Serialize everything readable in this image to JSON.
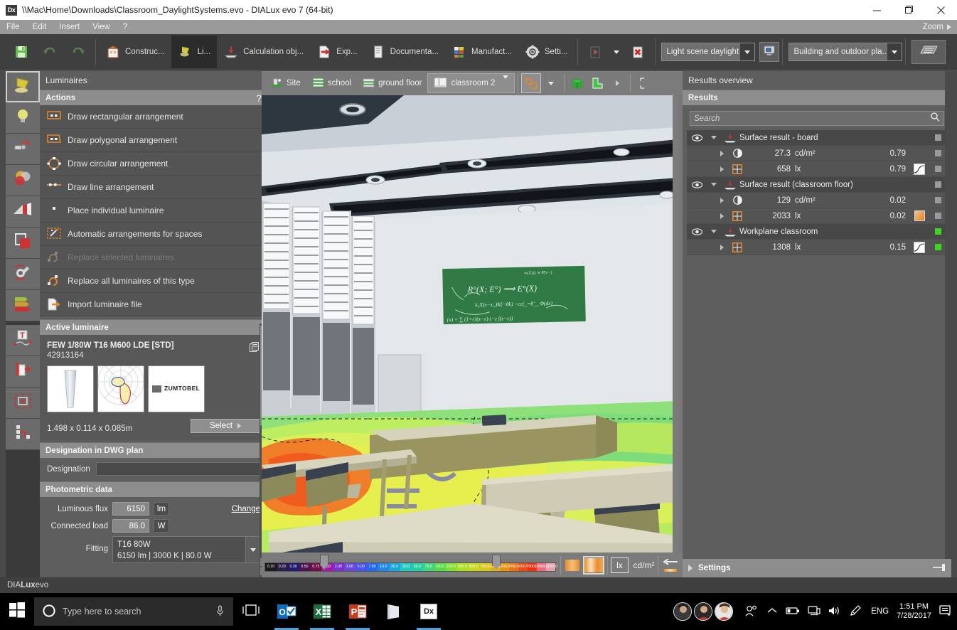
{
  "titlebar": {
    "app_icon": "dialux-icon",
    "title": "\\\\Mac\\Home\\Downloads\\Classroom_DaylightSystems.evo - DIALux evo 7  (64-bit)",
    "minimize": "—",
    "maximize": "❐",
    "close": "✕"
  },
  "menubar": {
    "items": [
      "File",
      "Edit",
      "Insert",
      "View",
      "?"
    ],
    "zoom_label": "Zoom"
  },
  "ribbon": {
    "save_label": "",
    "undo_label": "",
    "redo_label": "",
    "tabs": [
      {
        "label": "Construc...",
        "icon": "building-icon",
        "active": false
      },
      {
        "label": "Li...",
        "icon": "luminaire-icon",
        "active": true
      },
      {
        "label": "Calculation obj...",
        "icon": "calculation-object-icon",
        "active": false
      },
      {
        "label": "Exp...",
        "icon": "export-icon",
        "active": false
      },
      {
        "label": "Documenta...",
        "icon": "document-icon",
        "active": false
      },
      {
        "label": "Manufact...",
        "icon": "manufacturer-icon",
        "active": false
      },
      {
        "label": "Setti...",
        "icon": "gear-icon",
        "active": false
      }
    ],
    "calc_start_label": "",
    "calc_stop_label": "",
    "light_scene": "Light scene daylight",
    "light_scene_btn": "monitor-icon",
    "view_mode": "Building and outdoor pla...",
    "render_btn": "render-icon"
  },
  "rail": {
    "items": [
      {
        "name": "luminaire-tool",
        "icon": "spotlight-icon",
        "active": true
      },
      {
        "name": "lamp-tool",
        "icon": "bulb-icon",
        "active": false
      },
      {
        "name": "light-scene-tool",
        "icon": "light-scene-icon",
        "active": false
      },
      {
        "name": "color-tool",
        "icon": "color-circles-icon",
        "active": false
      },
      {
        "name": "light-direction-tool",
        "icon": "beam-icon",
        "active": false
      },
      {
        "name": "surface-tool",
        "icon": "surface-icon",
        "active": false
      },
      {
        "name": "maintenance-tool",
        "icon": "wrench-icon",
        "active": false
      },
      {
        "name": "false-color-tool",
        "icon": "bars-icon",
        "active": false
      },
      {
        "name": "text-tool",
        "icon": "text-curve-icon",
        "active": false
      },
      {
        "name": "add-object-tool",
        "icon": "add-object-icon",
        "active": false
      },
      {
        "name": "select-area-tool",
        "icon": "select-area-icon",
        "active": false
      },
      {
        "name": "node-tool",
        "icon": "node-path-icon",
        "active": false
      }
    ]
  },
  "left_panel": {
    "title": "Luminaires",
    "actions_header": "Actions",
    "help_glyph": "?",
    "actions": [
      {
        "label": "Draw rectangular arrangement",
        "icon": "rect-arrangement-icon",
        "disabled": false
      },
      {
        "label": "Draw polygonal arrangement",
        "icon": "polygon-arrangement-icon",
        "disabled": false
      },
      {
        "label": "Draw circular arrangement",
        "icon": "circular-arrangement-icon",
        "disabled": false
      },
      {
        "label": "Draw line arrangement",
        "icon": "line-arrangement-icon",
        "disabled": false
      },
      {
        "label": "Place individual luminaire",
        "icon": "single-luminaire-icon",
        "disabled": false
      },
      {
        "label": "Automatic arrangements for spaces",
        "icon": "magic-wand-icon",
        "disabled": false
      },
      {
        "label": "Replace selected luminaires",
        "icon": "replace-icon",
        "disabled": true
      },
      {
        "label": "Replace all luminaires of this type",
        "icon": "replace-all-icon",
        "disabled": false
      },
      {
        "label": "Import luminaire file",
        "icon": "import-file-icon",
        "disabled": false
      }
    ],
    "active_luminaire": {
      "header": "Active luminaire",
      "name": "FEW 1/80W T16 M600 LDE [STD]",
      "id": "42913164",
      "copy_icon": "copy-icon",
      "brand": "ZUMTOBEL",
      "dimensions": "1.498 x 0.114 x 0.085m",
      "select_label": "Select"
    },
    "dwg": {
      "header": "Designation in DWG plan",
      "label": "Designation",
      "value": "",
      "placeholder": ""
    },
    "photometric": {
      "header": "Photometric data",
      "luminous_flux_label": "Luminous flux",
      "luminous_flux_value": "6150",
      "luminous_flux_unit": "lm",
      "connected_load_label": "Connected load",
      "connected_load_value": "86.0",
      "connected_load_unit": "W",
      "change_label": "Change",
      "fitting_label": "Fitting",
      "fitting_line1": "T16  80W",
      "fitting_line2": "6150 lm  |  3000 K  |  80.0 W"
    }
  },
  "viewport": {
    "breadcrumb": [
      {
        "label": "Site",
        "icon": "site-icon",
        "selected": false
      },
      {
        "label": "school",
        "icon": "building-stack-icon",
        "selected": false
      },
      {
        "label": "ground floor",
        "icon": "floor-icon",
        "selected": false
      },
      {
        "label": "classroom 2",
        "icon": "room-icon",
        "selected": true
      }
    ],
    "room_dropdown_arrow": "chevron-down-icon",
    "tools": [
      {
        "name": "plan-view-toggle",
        "icon": "plan-icon",
        "selected": true
      },
      {
        "name": "plan-view-dropdown",
        "icon": "chevron-down-icon",
        "selected": false
      },
      {
        "name": "3d-cube-view",
        "icon": "cube-icon",
        "selected": false
      },
      {
        "name": "lshape-view",
        "icon": "lshape-icon",
        "selected": false
      },
      {
        "name": "more-views",
        "icon": "chevron-right-icon",
        "selected": false
      },
      {
        "name": "crop-view",
        "icon": "crop-icon",
        "selected": false
      }
    ],
    "scale": {
      "values": [
        "0.10",
        "0.20",
        "0.30",
        "0.50",
        "0.75",
        "1.00",
        "2.00",
        "3.00",
        "5.00",
        "7.50",
        "10.0",
        "20.0",
        "30.0",
        "50.0",
        "75.0",
        "100.0",
        "200.0",
        "300.0",
        "500.0",
        "750.0",
        "1000.0",
        "2000.0",
        "3000.0",
        "5000.0",
        "7500.0",
        "10000.0",
        "15000.0"
      ],
      "colors": [
        "#1a1a1a",
        "#2e1f4a",
        "#241a6b",
        "#4b1450",
        "#6e1046",
        "#a018a8",
        "#7b2fd1",
        "#6a45de",
        "#4a4ff0",
        "#2266f5",
        "#1f86f0",
        "#15a8d8",
        "#1ec8c0",
        "#22cfa0",
        "#3fd57a",
        "#56dc44",
        "#7fe02f",
        "#a8e022",
        "#c6d81c",
        "#d9c818",
        "#e2b014",
        "#e89212",
        "#ec7210",
        "#ef4a0e",
        "#f2300c",
        "#f06a7a",
        "#e9a0ac"
      ],
      "legend_solid": "legend-solid-icon",
      "legend_gradient": "legend-gradient-icon",
      "unit_lx": "lx",
      "unit_cdm2": "cd/m²",
      "reset_icon": "reset-arrow-icon"
    }
  },
  "right_panel": {
    "title": "Results overview",
    "results_header": "Results",
    "search_placeholder": "Search",
    "search_icon": "search-icon",
    "groups": [
      {
        "name": "Surface result - board",
        "icon": "surface-result-icon",
        "eye_icon": "eye-icon",
        "expand_icon": "chevron-down-icon",
        "status": "grey",
        "rows": [
          {
            "icon": "luminance-icon",
            "value": "27.3",
            "unit": "cd/m²",
            "ratio": "0.79",
            "swatch": "none",
            "status": "grey"
          },
          {
            "icon": "grid-icon",
            "value": "658",
            "unit": "lx",
            "ratio": "0.79",
            "swatch": "isoline",
            "status": "grey"
          }
        ]
      },
      {
        "name": "Surface result (classroom floor)",
        "icon": "surface-result-icon",
        "eye_icon": "eye-icon",
        "expand_icon": "chevron-down-icon",
        "status": "grey",
        "rows": [
          {
            "icon": "luminance-icon",
            "value": "129",
            "unit": "cd/m²",
            "ratio": "0.02",
            "swatch": "none",
            "status": "grey"
          },
          {
            "icon": "grid-icon",
            "value": "2033",
            "unit": "lx",
            "ratio": "0.02",
            "swatch": "orange",
            "status": "grey"
          }
        ]
      },
      {
        "name": "Workplane classroom",
        "icon": "surface-result-icon",
        "eye_icon": "eye-icon",
        "expand_icon": "chevron-down-icon",
        "status": "green",
        "rows": [
          {
            "icon": "grid-icon",
            "value": "1308",
            "unit": "lx",
            "ratio": "0.15",
            "swatch": "isoline",
            "status": "green"
          }
        ]
      }
    ],
    "settings_label": "Settings",
    "settings_expand_icon": "chevron-right-icon",
    "pin_icon": "pin-icon"
  },
  "statusbar": {
    "text_bold": "DIALux",
    "text_a": "DIA",
    "text_b": "Lux",
    "text_c": "evo"
  },
  "taskbar": {
    "start_icon": "windows-start-icon",
    "search_placeholder": "Type here to search",
    "cortana_icon": "cortana-circle-icon",
    "mic_icon": "microphone-icon",
    "taskview_icon": "task-view-icon",
    "apps": [
      {
        "name": "outlook",
        "label": "O",
        "color": "#0f6cbd",
        "active": true
      },
      {
        "name": "excel",
        "label": "X",
        "color": "#1d6f42",
        "active": true
      },
      {
        "name": "powerpoint",
        "label": "P",
        "color": "#c43e1c",
        "active": true
      },
      {
        "name": "onenote",
        "label": "N",
        "color": "#7719aa",
        "active": false
      },
      {
        "name": "dialux",
        "label": "Dx",
        "color": "#3a3a3a",
        "active": true
      }
    ],
    "tray": {
      "people_icon": "people-icon",
      "chevron_icon": "chevron-up-icon",
      "battery_icon": "battery-icon",
      "network_icon": "network-icon",
      "volume_icon": "volume-icon",
      "pen_icon": "pen-icon",
      "language": "ENG",
      "time": "1:51 PM",
      "date": "7/28/2017",
      "notifications_icon": "notifications-icon"
    }
  }
}
